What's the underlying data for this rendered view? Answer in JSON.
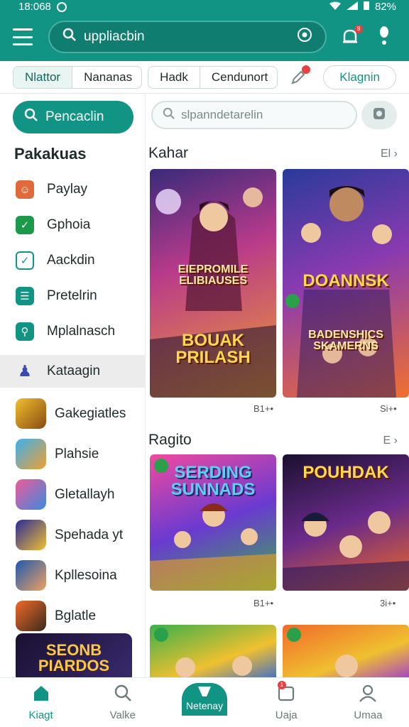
{
  "status": {
    "time": "18:068",
    "battery": "82%"
  },
  "app_bar": {
    "search_text": "uppliacbin",
    "notification_badge": "8"
  },
  "filter_tabs": {
    "tabs": [
      "Nlattor",
      "Nananas",
      "Hadk",
      "Cendunort"
    ],
    "active": 0,
    "pill": "Klagnin"
  },
  "sidebar": {
    "primary_button": "Pencaclin",
    "heading": "Pakakuas",
    "items": [
      {
        "label": "Paylay",
        "color": "#e06a3a",
        "icon": "gift-icon"
      },
      {
        "label": "Gphoia",
        "color": "#1a9a4a",
        "icon": "edit-icon"
      },
      {
        "label": "Aackdin",
        "color": "#129484",
        "icon": "check-icon"
      },
      {
        "label": "Pretelrin",
        "color": "#129484",
        "icon": "list-icon"
      },
      {
        "label": "Mplalnasch",
        "color": "#129484",
        "icon": "search-box-icon"
      }
    ],
    "selected": "Kataagin",
    "categories": [
      {
        "label": "Gakegiatles",
        "thumb": "#d8a820"
      },
      {
        "label": "Plahsie",
        "thumb": "#2a8ae0"
      },
      {
        "label": "Gletallayh",
        "thumb": "#e0508a"
      },
      {
        "label": "Spehada yt",
        "thumb": "#3a40c0"
      },
      {
        "label": "Kpllesoina",
        "thumb": "#2a7ad0"
      },
      {
        "label": "Bglatle",
        "thumb": "#d05a2a"
      }
    ],
    "banner": "SEONB PIARDOS"
  },
  "main": {
    "search_placeholder": "slpanndetarelin",
    "sections": [
      {
        "title": "Kahar",
        "more": "El",
        "cards": [
          {
            "title": "BOUAK PRILASH",
            "subtitle": "EIEPROMILE ELIBIAUSES",
            "meta": "B1+•"
          },
          {
            "title": "DOANNSK",
            "subtitle": "BADENSHICS SKAMERNS",
            "meta": "Si+•"
          }
        ]
      },
      {
        "title": "Ragito",
        "more": "E",
        "cards": [
          {
            "title": "SERDING SUNNADS",
            "subtitle": "",
            "meta": "B1+•"
          },
          {
            "title": "POUHDAK",
            "subtitle": "",
            "meta": "3i+•"
          }
        ]
      }
    ]
  },
  "bottom_nav": {
    "items": [
      "Kiagt",
      "Valke",
      "Netenay",
      "Uaja",
      "Umaa"
    ],
    "active": 0,
    "badge": "1"
  }
}
